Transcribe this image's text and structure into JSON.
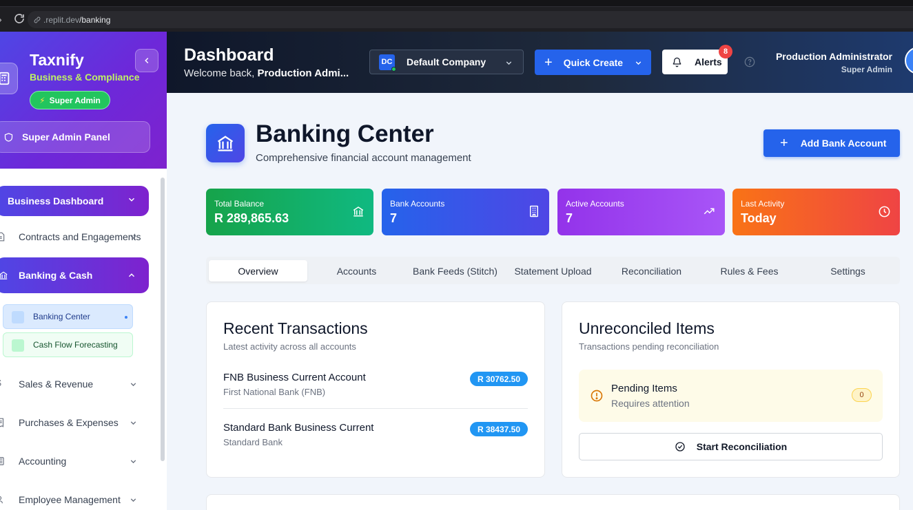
{
  "browser": {
    "url_host": ".replit.dev",
    "url_path": "/banking"
  },
  "sidebar": {
    "brand_name": "Taxnify",
    "brand_subtitle": "Business & Compliance",
    "role_badge": "Super Admin",
    "admin_panel_label": "Super Admin Panel",
    "items": [
      {
        "label": "Business Dashboard",
        "icon": "chevron-down-icon",
        "style": "primary"
      },
      {
        "label": "Contracts and Engagements",
        "icon": "document-icon"
      },
      {
        "label": "Banking & Cash",
        "icon": "bank-icon",
        "style": "primary-expanded"
      },
      {
        "label": "Banking Center",
        "sub": true,
        "active": true
      },
      {
        "label": "Cash Flow Forecasting",
        "sub": true
      },
      {
        "label": "Sales & Revenue",
        "icon": "dollar-icon"
      },
      {
        "label": "Purchases & Expenses",
        "icon": "receipt-icon"
      },
      {
        "label": "Accounting",
        "icon": "calculator-icon"
      },
      {
        "label": "Employee Management",
        "icon": "users-icon"
      }
    ]
  },
  "header": {
    "title": "Dashboard",
    "welcome_prefix": "Welcome back, ",
    "welcome_name": "Production Admi...",
    "company_initials": "DC",
    "company_name": "Default Company",
    "quick_create": "Quick Create",
    "alerts_label": "Alerts",
    "alerts_count": "8",
    "user_name": "Production Administrator",
    "user_role": "Super Admin"
  },
  "page": {
    "title": "Banking Center",
    "subtitle": "Comprehensive financial account management",
    "add_button": "Add Bank Account"
  },
  "stats": [
    {
      "label": "Total Balance",
      "value": "R 289,865.63",
      "icon": "bank-icon",
      "color": "#16a34a"
    },
    {
      "label": "Bank Accounts",
      "value": "7",
      "icon": "building-icon",
      "color": "#3b5bf0"
    },
    {
      "label": "Active Accounts",
      "value": "7",
      "icon": "trending-up-icon",
      "color": "#9333ea"
    },
    {
      "label": "Last Activity",
      "value": "Today",
      "icon": "clock-icon",
      "color": "#f97316"
    }
  ],
  "tabs": [
    "Overview",
    "Accounts",
    "Bank Feeds (Stitch)",
    "Statement Upload",
    "Reconciliation",
    "Rules & Fees",
    "Settings"
  ],
  "recent_transactions": {
    "title": "Recent Transactions",
    "subtitle": "Latest activity across all accounts",
    "items": [
      {
        "name": "FNB Business Current Account",
        "bank": "First National Bank (FNB)",
        "amount": "R 30762.50"
      },
      {
        "name": "Standard Bank Business Current",
        "bank": "Standard Bank",
        "amount": "R 38437.50"
      }
    ]
  },
  "unreconciled": {
    "title": "Unreconciled Items",
    "subtitle": "Transactions pending reconciliation",
    "pending_title": "Pending Items",
    "pending_sub": "Requires attention",
    "pending_count": "0",
    "button": "Start Reconciliation"
  }
}
